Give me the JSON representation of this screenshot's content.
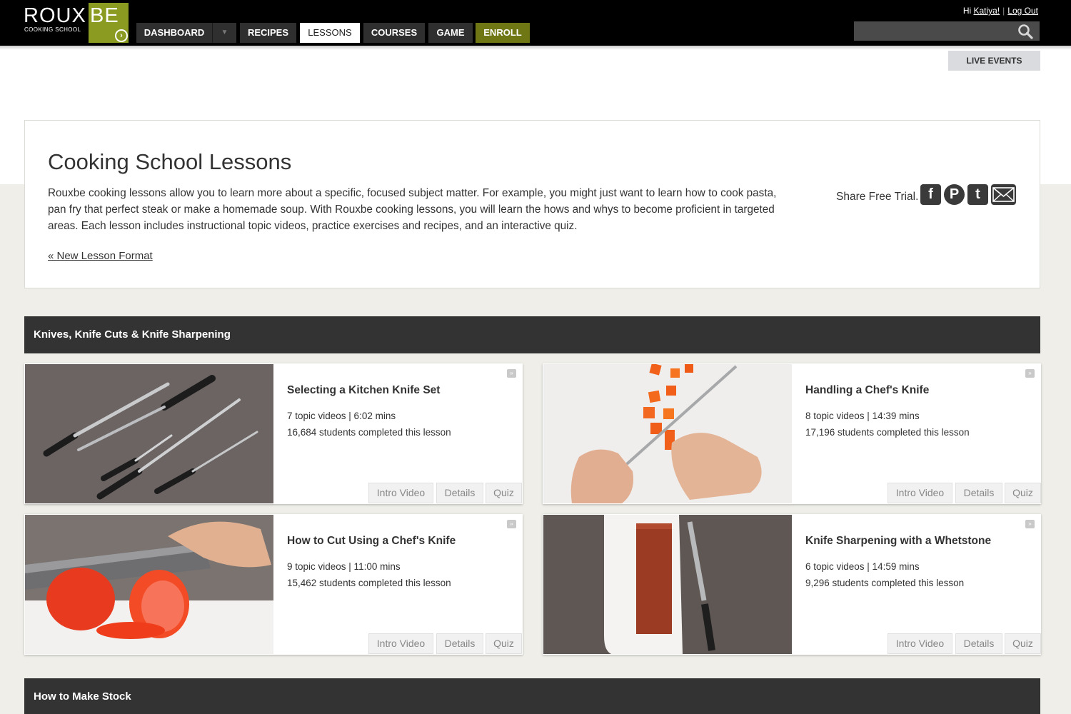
{
  "brand": {
    "logo_left": "ROUX",
    "logo_right": "BE",
    "logo_sub": "COOKING SCHOOL",
    "accent_color": "#8b9b22"
  },
  "nav": {
    "items": [
      {
        "label": "DASHBOARD"
      },
      {
        "label": "RECIPES"
      },
      {
        "label": "LESSONS"
      },
      {
        "label": "COURSES"
      },
      {
        "label": "GAME"
      },
      {
        "label": "ENROLL"
      }
    ],
    "dropdown_icon": "▼",
    "active": "LESSONS"
  },
  "user": {
    "greeting_prefix": "Hi ",
    "name": "Katiya!",
    "logout": "Log Out",
    "separator": "|"
  },
  "search": {
    "placeholder": "",
    "icon": "search-icon"
  },
  "live_events": "LIVE EVENTS",
  "intro": {
    "title": "Cooking School Lessons",
    "body": "Rouxbe cooking lessons allow you to learn more about a specific, focused subject matter. For example, you might just want to learn how to cook pasta, pan fry that perfect steak or make a homemade soup. With Rouxbe cooking lessons, you will learn the hows and whys to become proficient in targeted areas. Each lesson includes instructional topic videos, practice exercises and recipes, and an interactive quiz.",
    "link": "« New Lesson Format",
    "share_label": "Share Free Trial."
  },
  "share_icons": [
    "facebook-icon",
    "pinterest-icon",
    "twitter-icon",
    "email-icon"
  ],
  "sections": [
    {
      "title": "Knives, Knife Cuts & Knife Sharpening",
      "lessons": [
        {
          "title": "Selecting a Kitchen Knife Set",
          "meta": "7 topic videos | 6:02 mins",
          "students": "16,684 students completed this lesson"
        },
        {
          "title": "Handling a Chef's Knife",
          "meta": "8 topic videos | 14:39 mins",
          "students": "17,196 students completed this lesson"
        },
        {
          "title": "How to Cut Using a Chef's Knife",
          "meta": "9 topic videos | 11:00 mins",
          "students": "15,462 students completed this lesson"
        },
        {
          "title": "Knife Sharpening with a Whetstone",
          "meta": "6 topic videos | 14:59 mins",
          "students": "9,296 students completed this lesson"
        }
      ]
    },
    {
      "title": "How to Make Stock",
      "lessons": []
    }
  ],
  "lesson_buttons": {
    "intro": "Intro Video",
    "details": "Details",
    "quiz": "Quiz"
  }
}
